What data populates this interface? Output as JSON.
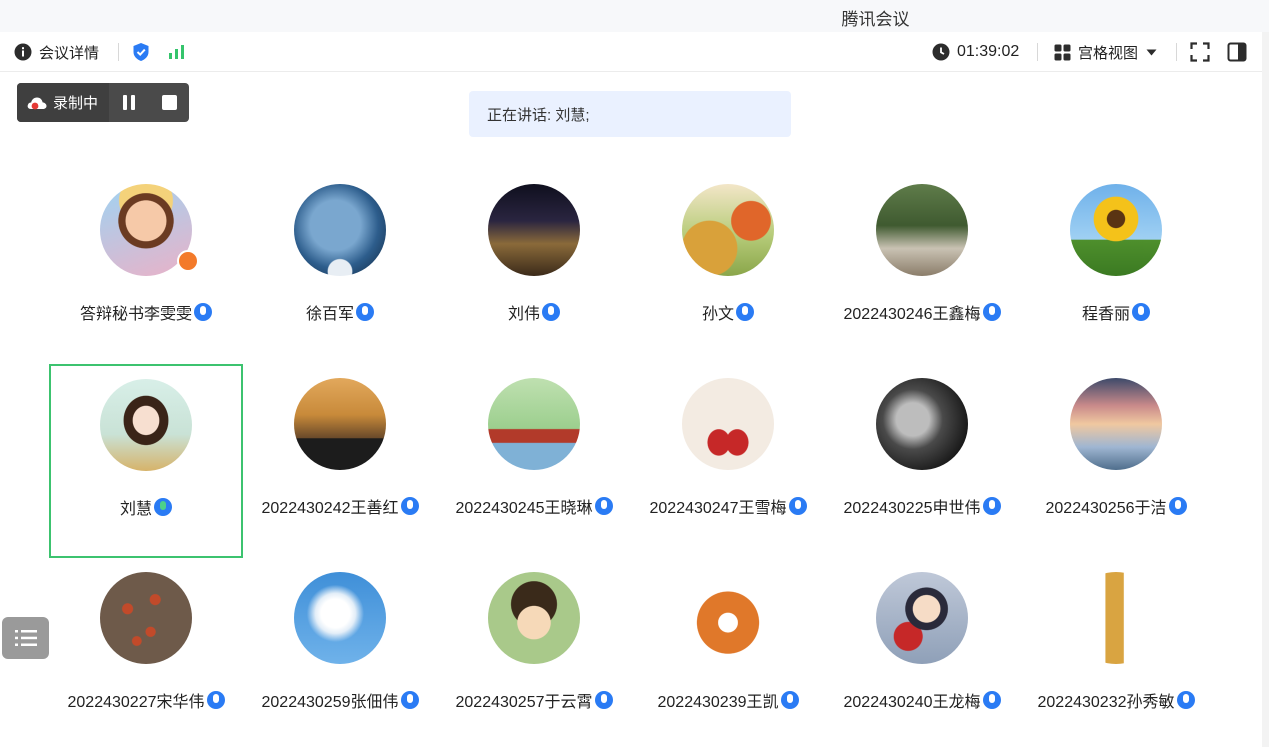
{
  "app": {
    "title": "腾讯会议"
  },
  "toolbar": {
    "meeting_info": "会议详情",
    "timer": "01:39:02",
    "view_mode": "宫格视图"
  },
  "recording": {
    "label": "录制中"
  },
  "speaking": {
    "text": "正在讲话: 刘慧;"
  },
  "participants": [
    {
      "name": "答辩秘书李雯雯",
      "avatar": "anime-girl-avatar"
    },
    {
      "name": "徐百军",
      "avatar": "planet-avatar"
    },
    {
      "name": "刘伟",
      "avatar": "night-town-avatar"
    },
    {
      "name": "孙文",
      "avatar": "autumn-trees-avatar"
    },
    {
      "name": "2022430246王鑫梅",
      "avatar": "forest-photo-avatar"
    },
    {
      "name": "程香丽",
      "avatar": "sunflower-avatar"
    },
    {
      "name": "刘慧",
      "avatar": "illustrated-woman-avatar",
      "active": true
    },
    {
      "name": "2022430242王善红",
      "avatar": "camel-desert-avatar"
    },
    {
      "name": "2022430245王晓琳",
      "avatar": "anime-bridge-avatar"
    },
    {
      "name": "2022430247王雪梅",
      "avatar": "couple-illustration-avatar"
    },
    {
      "name": "2022430225申世伟",
      "avatar": "bw-portrait-avatar"
    },
    {
      "name": "2022430256于洁",
      "avatar": "sunset-clouds-avatar"
    },
    {
      "name": "2022430227宋华伟",
      "avatar": "petals-avatar"
    },
    {
      "name": "2022430259张佃伟",
      "avatar": "blue-sky-avatar"
    },
    {
      "name": "2022430257于云霄",
      "avatar": "cartoon-boy-avatar"
    },
    {
      "name": "2022430239王凯",
      "avatar": "tiger-avatar"
    },
    {
      "name": "2022430240王龙梅",
      "avatar": "anime-boy-avatar"
    },
    {
      "name": "2022430232孙秀敏",
      "avatar": "giraffe-kid-avatar"
    }
  ],
  "colors": {
    "accent": "#2a7bf4",
    "active_border": "#3cc36f",
    "speaking_bg": "#eaf1ff",
    "signal": "#35c46c",
    "host_badge": "#f37a2a"
  }
}
